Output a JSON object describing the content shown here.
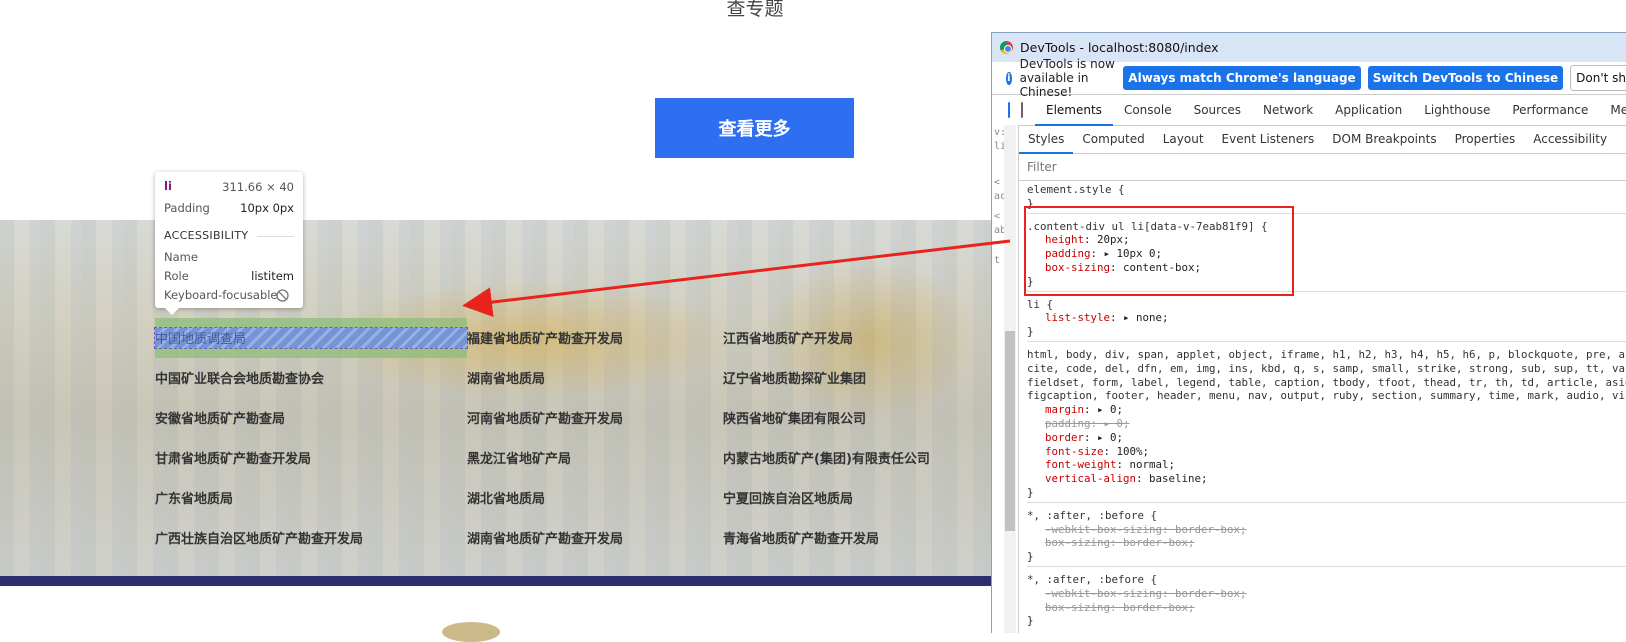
{
  "page": {
    "title": "查专题",
    "more_button": "查看更多",
    "orgs": [
      [
        "中国地质调查局",
        "福建省地质矿产勘查开发局",
        "江西省地质矿产开发局"
      ],
      [
        "中国矿业联合会地质勘查协会",
        "湖南省地质局",
        "辽宁省地质勘探矿业集团"
      ],
      [
        "安徽省地质矿产勘查局",
        "河南省地质矿产勘查开发局",
        "陕西省地矿集团有限公司"
      ],
      [
        "甘肃省地质矿产勘查开发局",
        "黑龙江省地矿产局",
        "内蒙古地质矿产(集团)有限责任公司"
      ],
      [
        "广东省地质局",
        "湖北省地质局",
        "宁夏回族自治区地质局"
      ],
      [
        "广西壮族自治区地质矿产勘查开发局",
        "湖南省地质矿产勘查开发局",
        "青海省地质矿产勘查开发局"
      ]
    ]
  },
  "tooltip": {
    "tag": "li",
    "size": "311.66 × 40",
    "padding_label": "Padding",
    "padding_value": "10px 0px",
    "section": "ACCESSIBILITY",
    "name_label": "Name",
    "name_value": "",
    "role_label": "Role",
    "role_value": "listitem",
    "keyboard_label": "Keyboard-focusable",
    "keyboard_icon": "not-allowed-icon"
  },
  "devtools": {
    "window_title": "DevTools - localhost:8080/index",
    "info_text": "DevTools is now available in Chinese!",
    "btn_match": "Always match Chrome's language",
    "btn_switch": "Switch DevTools to Chinese",
    "btn_dont": "Don't sh",
    "tabs": [
      "Elements",
      "Console",
      "Sources",
      "Network",
      "Application",
      "Lighthouse",
      "Performance",
      "Mem"
    ],
    "subtabs": [
      "Styles",
      "Computed",
      "Layout",
      "Event Listeners",
      "DOM Breakpoints",
      "Properties",
      "Accessibility"
    ],
    "filter_placeholder": "Filter",
    "left_gutter": [
      "v:",
      "li",
      "",
      "<",
      "ac",
      "<",
      "ab",
      "<",
      "t"
    ],
    "rules": {
      "element_style": "element.style {",
      "close": "}",
      "content_selector": ".content-div ul li[data-v-7eab81f9] {",
      "height_prop": "height",
      "height_val": "20px;",
      "padding_prop": "padding",
      "padding_val": "10px 0;",
      "boxsizing_prop": "box-sizing",
      "boxsizing_val": "content-box;",
      "li_selector": "li {",
      "liststyle_prop": "list-style",
      "liststyle_val": "none;",
      "reset_sel1": "html, body, div, span, applet, object, iframe, h1, h2, h3, h4, h5, h6, p, blockquote, pre, a,",
      "reset_sel2": "cite, code, del, dfn, em, img, ins, kbd, q, s, samp, small, strike, strong, sub, sup, tt, var,",
      "reset_sel3": "fieldset, form, label, legend, table, caption, tbody, tfoot, thead, tr, th, td, article, aside,",
      "reset_sel4": "figcaption, footer, header, menu, nav, output, ruby, section, summary, time, mark, audio, vi",
      "margin_prop": "margin",
      "margin_val": "0;",
      "padding2_prop": "padding",
      "padding2_val": "0;",
      "border_prop": "border",
      "border_val": "0;",
      "fontsize_prop": "font-size",
      "fontsize_val": "100%;",
      "fontweight_prop": "font-weight",
      "fontweight_val": "normal;",
      "valign_prop": "vertical-align",
      "valign_val": "baseline;",
      "star_selector": "*, :after, :before {",
      "wk_prop": "-webkit-box-sizing",
      "wk_val": "border-box;",
      "bs_prop": "box-sizing",
      "bs_val": "border-box;"
    }
  },
  "colors": {
    "accent_blue": "#2d6ff0",
    "annotation_red": "#e8231c"
  }
}
